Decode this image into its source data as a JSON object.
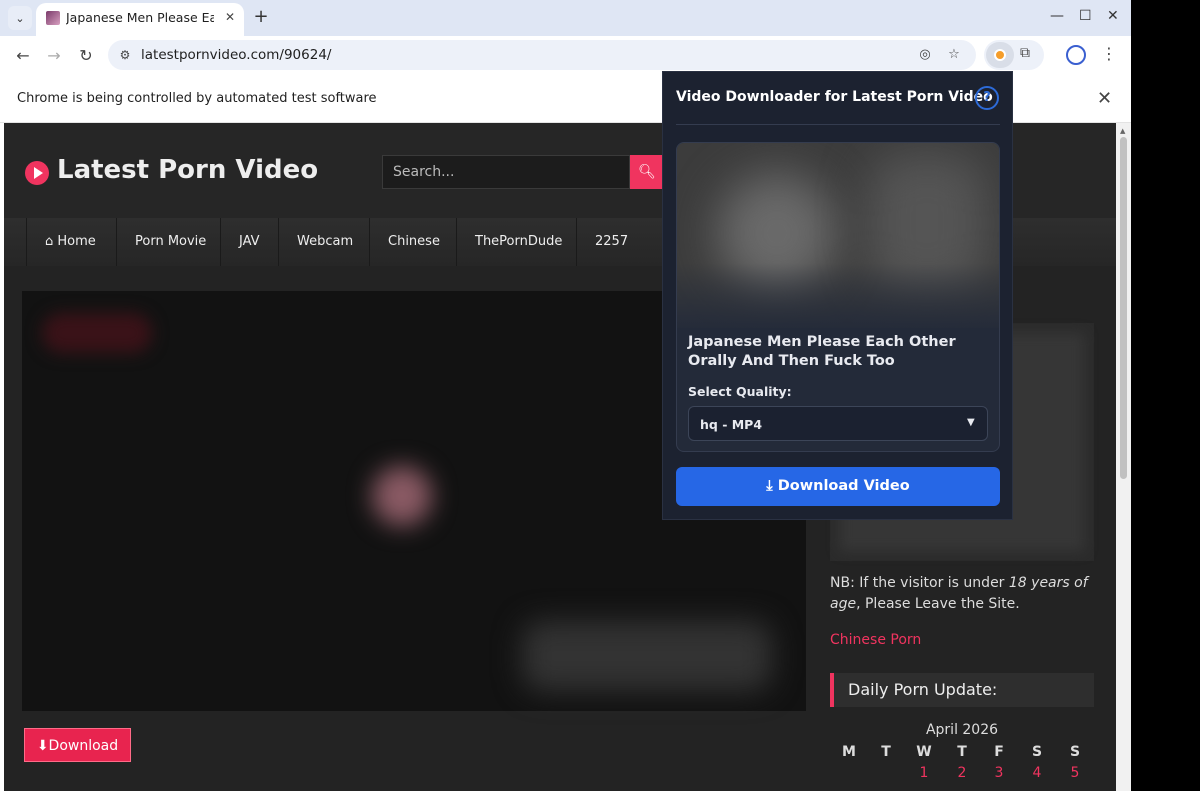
{
  "tab": {
    "title": "Japanese Men Please Each Other Orally And Then Fuck Too",
    "close": "✕",
    "new": "+"
  },
  "window": {
    "minimize": "—",
    "maximize": "☐",
    "close": "✕"
  },
  "address": {
    "url": "latestpornvideo.com/90624/"
  },
  "infobar": {
    "text": "Chrome is being controlled by automated test software",
    "close": "✕"
  },
  "site": {
    "logo": "Latest Porn Video",
    "search_placeholder": "Search...",
    "nav": [
      "Home",
      "Porn Movie",
      "JAV",
      "Webcam",
      "Chinese",
      "ThePornDude",
      "2257"
    ],
    "download_button": "⬇Download",
    "nb_prefix": "NB: If the visitor is under ",
    "nb_em": "18 years of age",
    "nb_suffix": ", Please Leave the Site.",
    "chinese_link": "Chinese Porn",
    "daily_heading": "Daily Porn Update:",
    "calendar": {
      "month": "April 2026",
      "weekdays": [
        "M",
        "T",
        "W",
        "T",
        "F",
        "S",
        "S"
      ],
      "row1": [
        "",
        "",
        "1",
        "2",
        "3",
        "4",
        "5"
      ]
    }
  },
  "popup": {
    "title": "Video Downloader for Latest Porn Video",
    "help": "?",
    "video_title": "Japanese Men Please Each Other Orally And Then Fuck Too",
    "quality_label": "Select Quality:",
    "quality_value": "hq - MP4",
    "download_label": "Download Video"
  },
  "colors": {
    "accent": "#f0345f",
    "popup_button": "#2667e6"
  }
}
